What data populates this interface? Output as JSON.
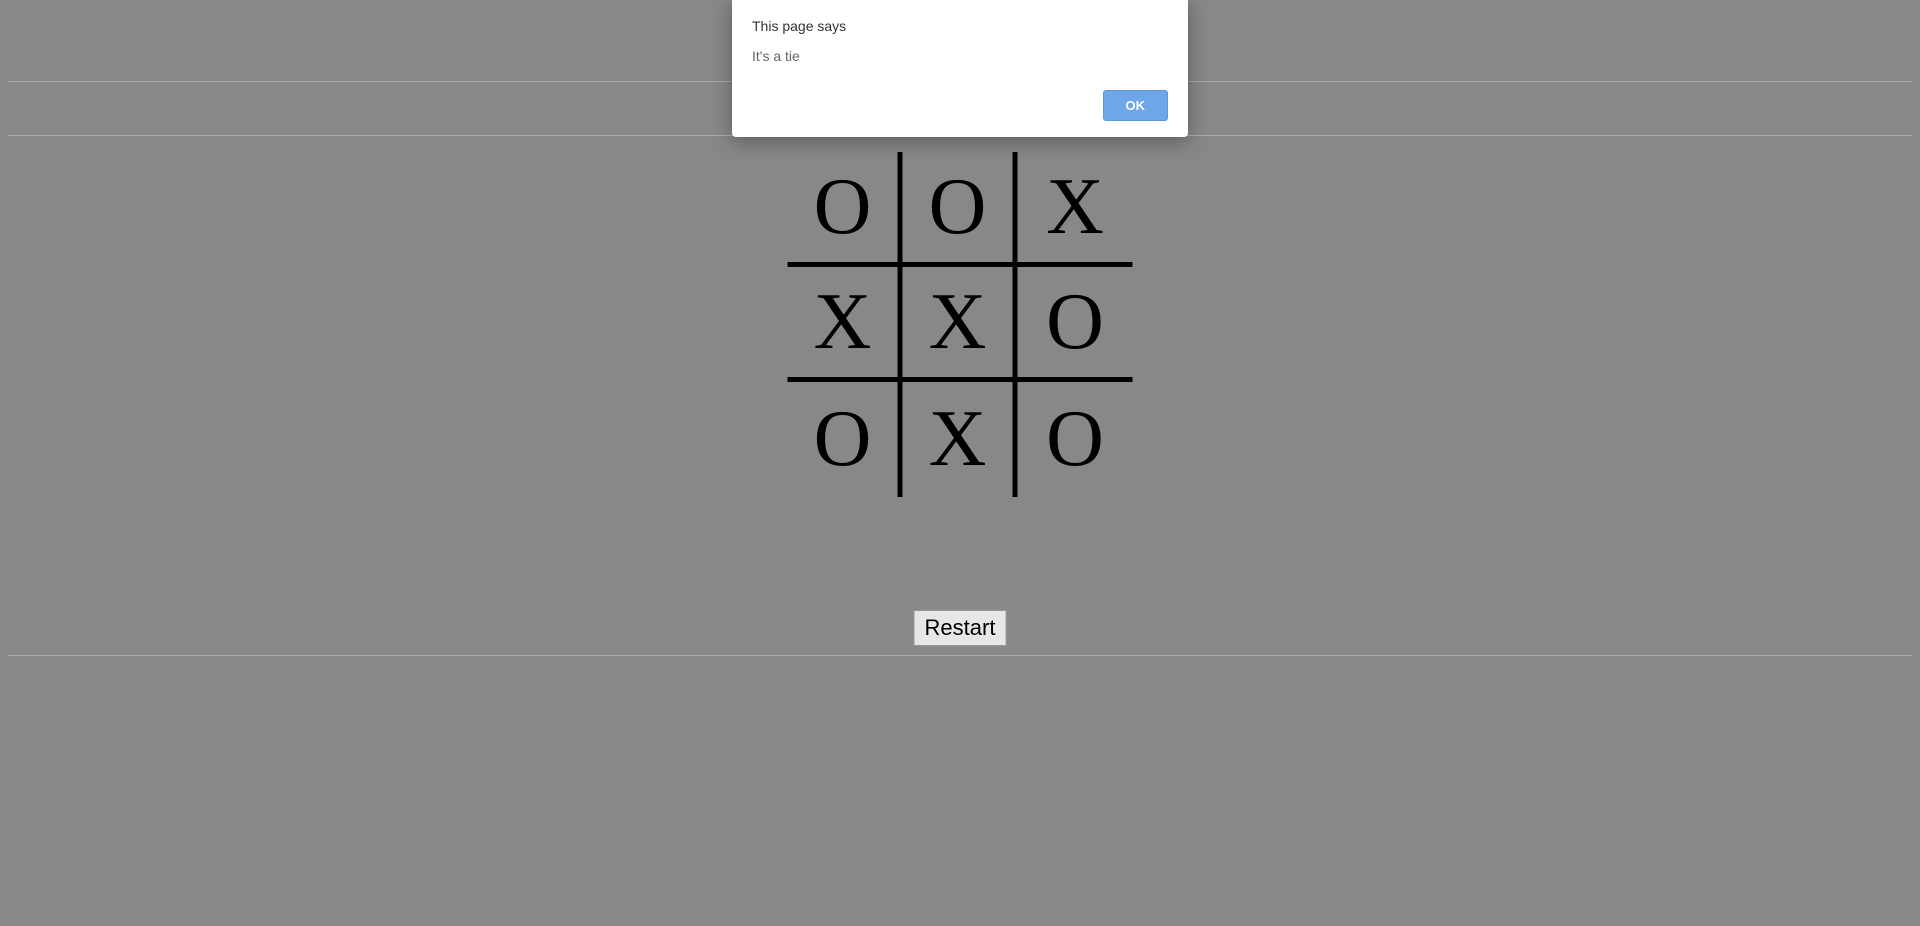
{
  "dialog": {
    "title": "This page says",
    "message": "It's a tie",
    "ok_label": "OK"
  },
  "board": {
    "cells": [
      "O",
      "O",
      "X",
      "X",
      "X",
      "O",
      "O",
      "X",
      "O"
    ]
  },
  "controls": {
    "restart_label": "Restart"
  }
}
